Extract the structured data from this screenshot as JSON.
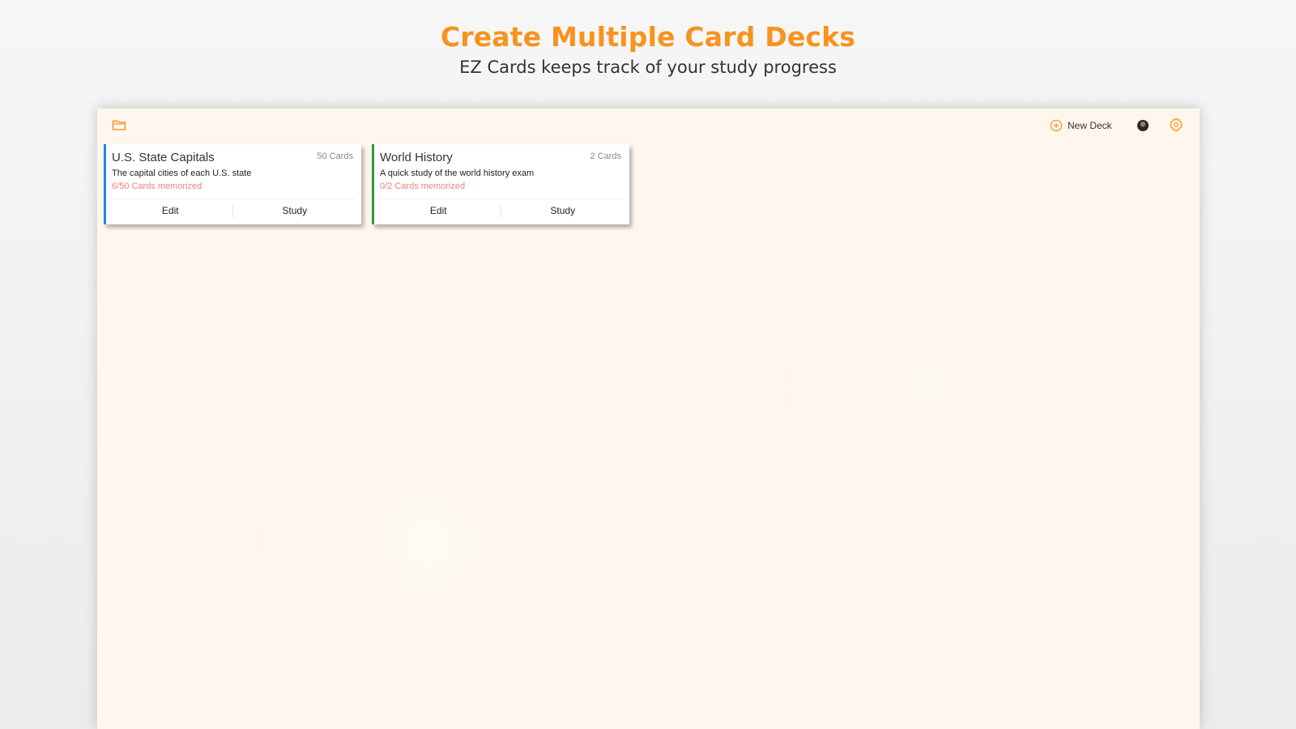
{
  "hero": {
    "title": "Create Multiple Card Decks",
    "subtitle": "EZ Cards keeps track of your study progress"
  },
  "toolbar": {
    "folder_icon": "folder-icon",
    "new_deck_icon": "plus-circle-icon",
    "new_deck_label": "New Deck",
    "avatar": "user-avatar",
    "settings_icon": "gear-icon"
  },
  "decks": [
    {
      "name": "U.S. State Capitals",
      "count": "50 Cards",
      "description": "The capital cities of each U.S. state",
      "progress": "6/50 Cards memorized",
      "accent_color": "#1e88e5",
      "edit_label": "Edit",
      "study_label": "Study"
    },
    {
      "name": "World History",
      "count": "2 Cards",
      "description": "A quick study of the world history exam",
      "progress": "0/2 Cards memorized",
      "accent_color": "#2e9d3a",
      "edit_label": "Edit",
      "study_label": "Study"
    }
  ],
  "colors": {
    "brand_orange": "#f7931e",
    "progress_text": "#f08080",
    "app_background": "#fff7ee"
  }
}
